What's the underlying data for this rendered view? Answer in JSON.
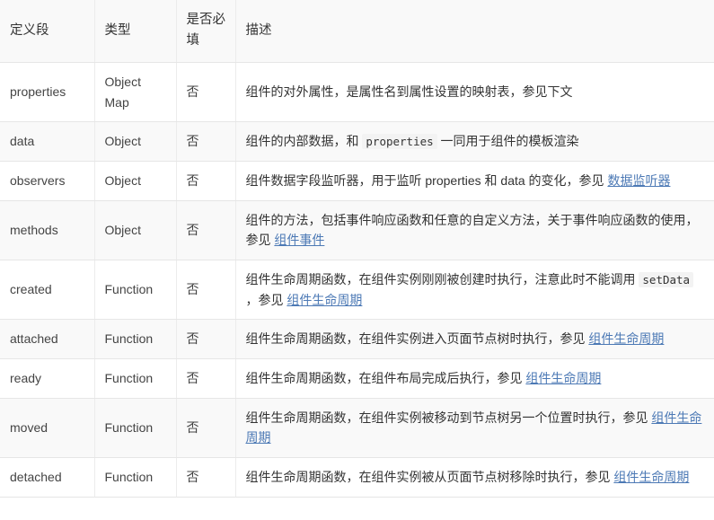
{
  "table": {
    "headers": [
      {
        "label": "定义段"
      },
      {
        "label": "类型"
      },
      {
        "label": "是否必填"
      },
      {
        "label": "描述"
      }
    ],
    "rows": [
      {
        "field": "properties",
        "type": "Object Map",
        "required": "否",
        "desc_parts": [
          {
            "kind": "text",
            "text": "组件的对外属性，是属性名到属性设置的映射表，参见下文"
          }
        ]
      },
      {
        "field": "data",
        "type": "Object",
        "required": "否",
        "desc_parts": [
          {
            "kind": "text",
            "text": "组件的内部数据，和 "
          },
          {
            "kind": "code",
            "text": "properties"
          },
          {
            "kind": "text",
            "text": " 一同用于组件的模板渲染"
          }
        ]
      },
      {
        "field": "observers",
        "type": "Object",
        "required": "否",
        "desc_parts": [
          {
            "kind": "text",
            "text": "组件数据字段监听器，用于监听 properties 和 data 的变化，参见 "
          },
          {
            "kind": "link",
            "text": "数据监听器"
          }
        ]
      },
      {
        "field": "methods",
        "type": "Object",
        "required": "否",
        "desc_parts": [
          {
            "kind": "text",
            "text": "组件的方法，包括事件响应函数和任意的自定义方法，关于事件响应函数的使用，参见 "
          },
          {
            "kind": "link",
            "text": "组件事件"
          }
        ]
      },
      {
        "field": "created",
        "type": "Function",
        "required": "否",
        "desc_parts": [
          {
            "kind": "text",
            "text": "组件生命周期函数，在组件实例刚刚被创建时执行，注意此时不能调用 "
          },
          {
            "kind": "code",
            "text": "setData"
          },
          {
            "kind": "text",
            "text": " ，参见 "
          },
          {
            "kind": "link",
            "text": "组件生命周期"
          }
        ]
      },
      {
        "field": "attached",
        "type": "Function",
        "required": "否",
        "desc_parts": [
          {
            "kind": "text",
            "text": "组件生命周期函数，在组件实例进入页面节点树时执行，参见 "
          },
          {
            "kind": "link",
            "text": "组件生命周期"
          }
        ]
      },
      {
        "field": "ready",
        "type": "Function",
        "required": "否",
        "desc_parts": [
          {
            "kind": "text",
            "text": "组件生命周期函数，在组件布局完成后执行，参见 "
          },
          {
            "kind": "link",
            "text": "组件生命周期"
          }
        ]
      },
      {
        "field": "moved",
        "type": "Function",
        "required": "否",
        "desc_parts": [
          {
            "kind": "text",
            "text": "组件生命周期函数，在组件实例被移动到节点树另一个位置时执行，参见 "
          },
          {
            "kind": "link",
            "text": "组件生命周期"
          }
        ]
      },
      {
        "field": "detached",
        "type": "Function",
        "required": "否",
        "desc_parts": [
          {
            "kind": "text",
            "text": "组件生命周期函数，在组件实例被从页面节点树移除时执行，参见 "
          },
          {
            "kind": "link",
            "text": "组件生命周期"
          }
        ]
      }
    ]
  },
  "colors": {
    "link": "#4c79b5",
    "text": "#333333",
    "row_shade": "#f9f9f9",
    "border": "#e6e6e6",
    "code_bg": "#f3f3f3"
  }
}
